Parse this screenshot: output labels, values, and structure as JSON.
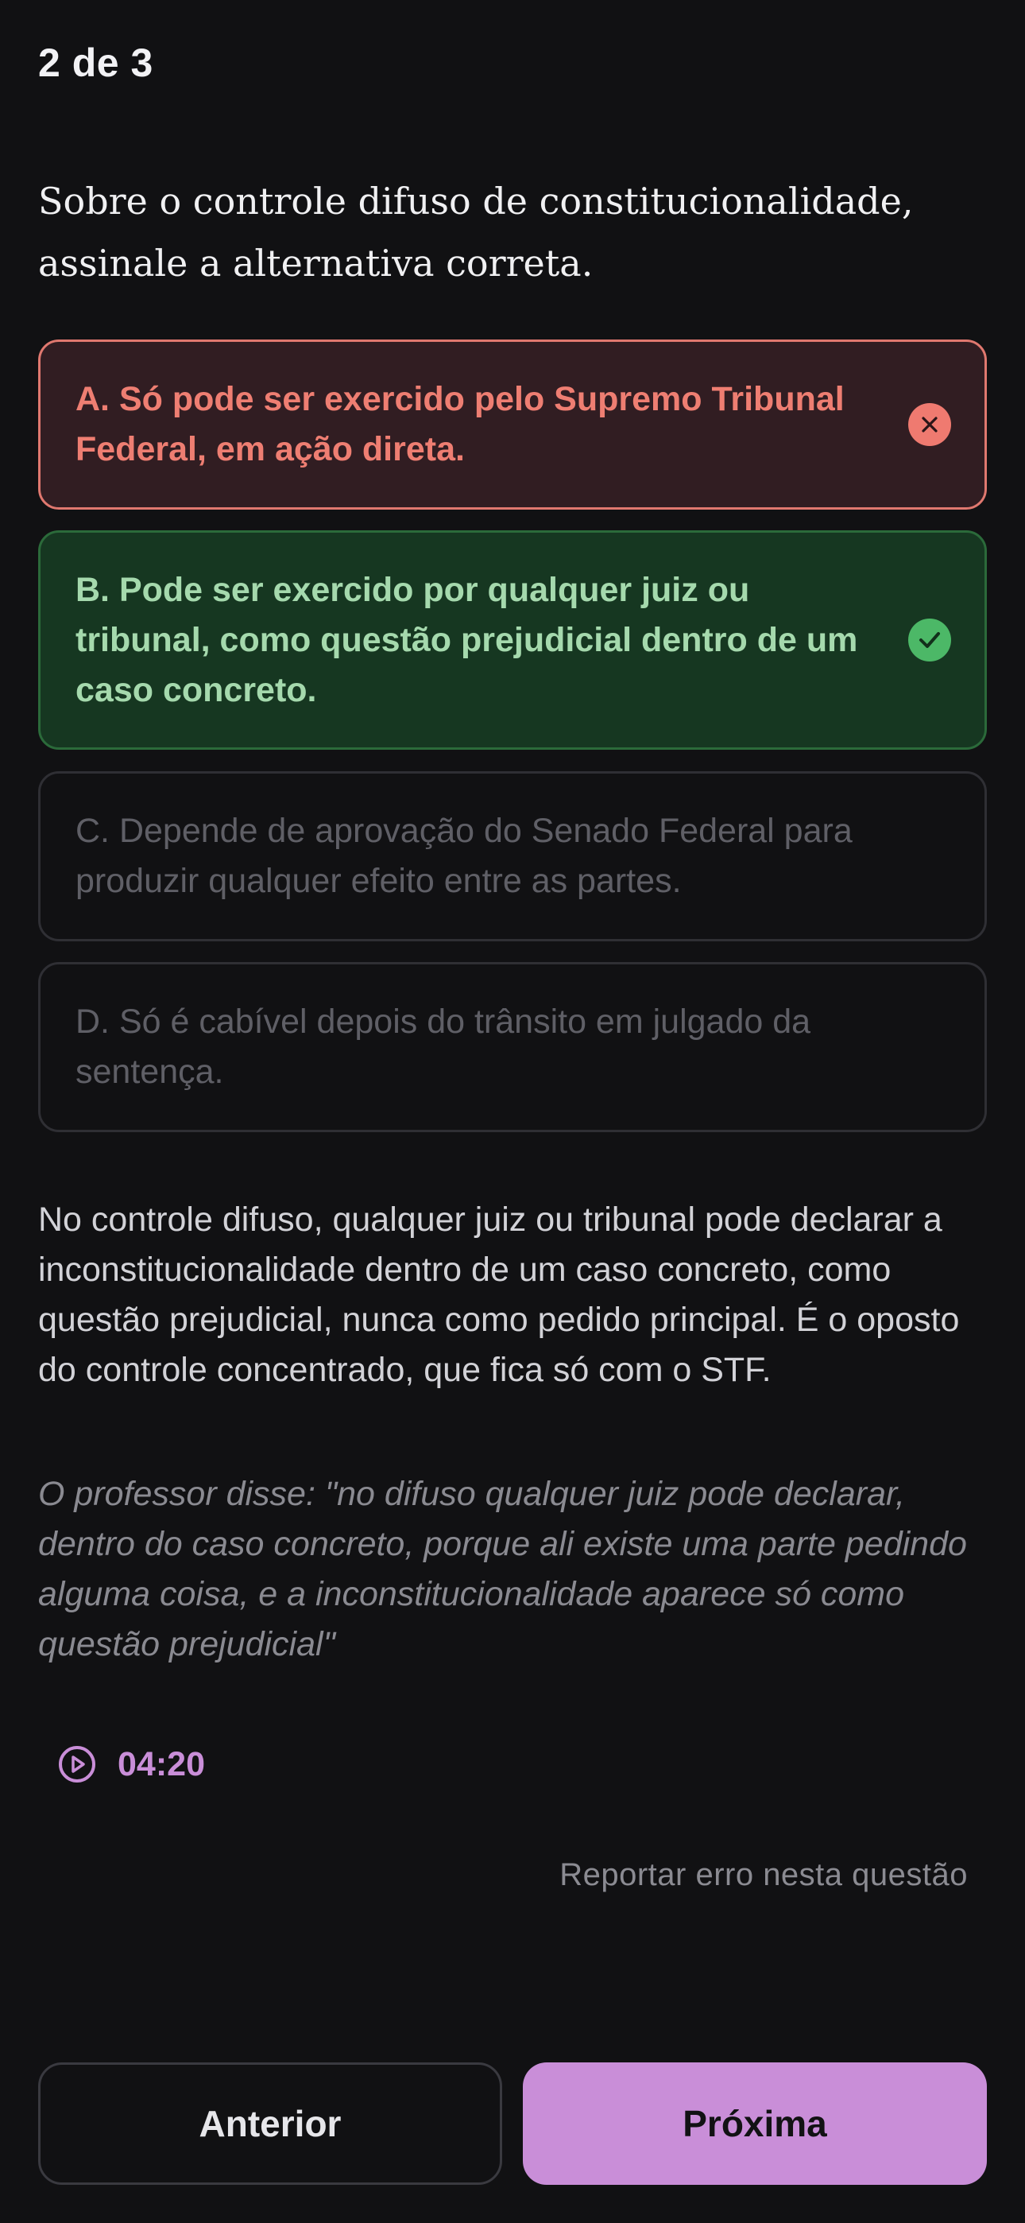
{
  "header": {
    "counter": "2 de 3"
  },
  "question": {
    "text": "Sobre o controle difuso de constitucionalidade, assinale a alternativa correta."
  },
  "options": [
    {
      "text": "A. Só pode ser exercido pelo Supremo Tribunal Federal, em ação direta.",
      "state": "wrong",
      "icon": "x-circle-icon"
    },
    {
      "text": "B. Pode ser exercido por qualquer juiz ou tribunal, como questão prejudicial dentro de um caso concreto.",
      "state": "correct",
      "icon": "check-circle-icon"
    },
    {
      "text": "C. Depende de aprovação do Senado Federal para produzir qualquer efeito entre as partes.",
      "state": "neutral"
    },
    {
      "text": "D. Só é cabível depois do trânsito em julgado da sentença.",
      "state": "neutral"
    }
  ],
  "explanation": {
    "text": "No controle difuso, qualquer juiz ou tribunal pode declarar a inconstitucionalidade dentro de um caso concreto, como questão prejudicial, nunca como pedido principal. É o oposto do controle concentrado, que fica só com o STF.",
    "quote": "O professor disse: \"no difuso qualquer juiz pode declarar, dentro do caso concreto, porque ali existe uma parte pedindo alguma coisa, e a inconstitucionalidade aparece só como questão prejudicial\"",
    "timestamp": "04:20",
    "timestamp_icon": "play-circle-icon"
  },
  "report": {
    "label": "Reportar erro nesta questão"
  },
  "navigation": {
    "prev_label": "Anterior",
    "next_label": "Próxima"
  },
  "colors": {
    "background": "#111113",
    "wrong": "#ee7e72",
    "correct": "#4cb867",
    "accent": "#c98ed8"
  }
}
